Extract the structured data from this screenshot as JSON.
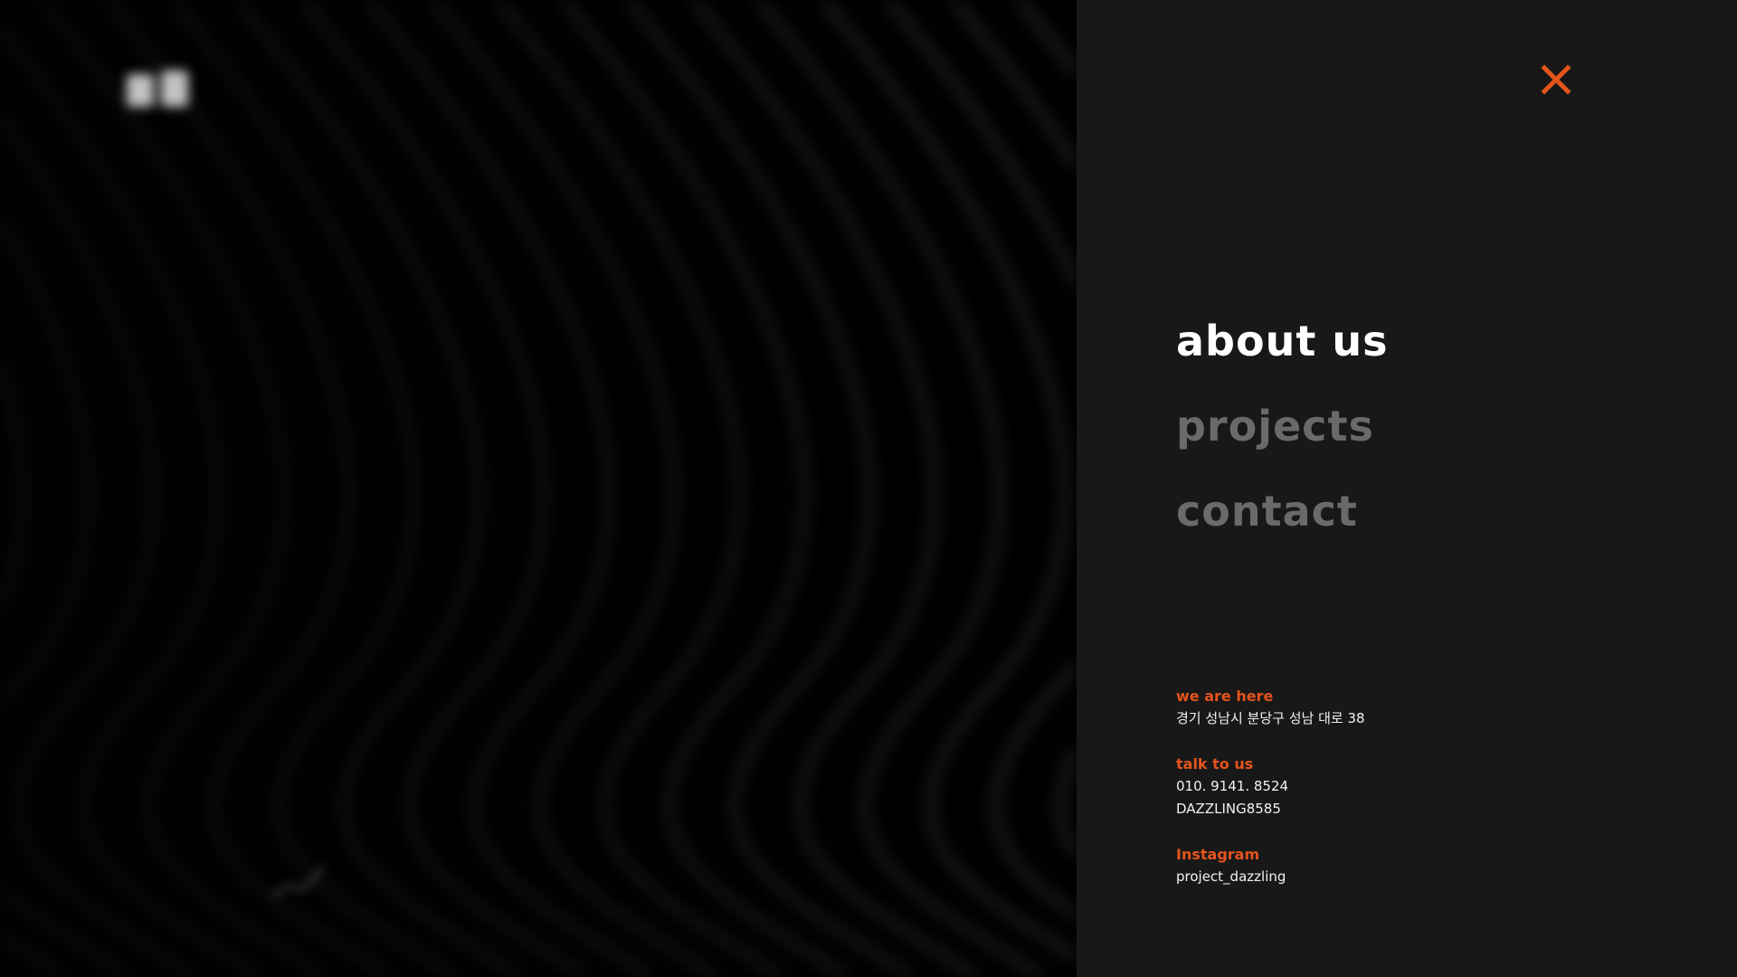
{
  "nav": {
    "close_icon": "close-icon",
    "items": [
      {
        "label": "about us",
        "state": "active"
      },
      {
        "label": "projects",
        "state": "inactive"
      },
      {
        "label": "contact",
        "state": "inactive"
      }
    ]
  },
  "info": {
    "location": {
      "heading": "we are here",
      "address": "경기 성남시 분당구 성남 대로 38"
    },
    "talk": {
      "heading": "talk to us",
      "phone": "010. 9141. 8524",
      "id": "DAZZLING8585"
    },
    "instagram": {
      "heading": "Instagram",
      "handle": "project_dazzling"
    }
  },
  "colors": {
    "accent": "#e4541c",
    "panel": "#181818",
    "active": "#ffffff",
    "inactive": "#6a6a6a"
  }
}
